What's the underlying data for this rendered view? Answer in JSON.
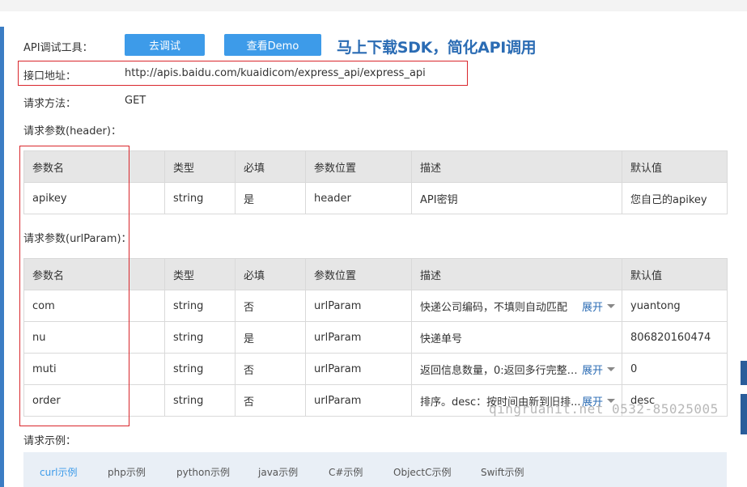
{
  "colors": {
    "accent": "#3d9be9",
    "link": "#2b6cb4",
    "highlight_box": "#d9262c",
    "header_bg": "#e6e6e6"
  },
  "api_tools": {
    "label": "API调试工具：",
    "debug_button": "去调试",
    "demo_button": "查看Demo",
    "promo_text": "马上下载SDK，简化API调用"
  },
  "endpoint": {
    "label": "接口地址：",
    "url": "http://apis.baidu.com/kuaidicom/express_api/express_api"
  },
  "method": {
    "label": "请求方法：",
    "value": "GET"
  },
  "header_params": {
    "title": "请求参数(header)：",
    "columns": [
      "参数名",
      "类型",
      "必填",
      "参数位置",
      "描述",
      "默认值"
    ],
    "rows": [
      {
        "name": "apikey",
        "type": "string",
        "required": "是",
        "location": "header",
        "desc": "API密钥",
        "default": "您自己的apikey"
      }
    ]
  },
  "url_params": {
    "title": "请求参数(urlParam)：",
    "columns": [
      "参数名",
      "类型",
      "必填",
      "参数位置",
      "描述",
      "默认值"
    ],
    "expand_label": "展开",
    "rows": [
      {
        "name": "com",
        "type": "string",
        "required": "否",
        "location": "urlParam",
        "desc": "快递公司编码，不填则自动匹配",
        "default": "yuantong"
      },
      {
        "name": "nu",
        "type": "string",
        "required": "是",
        "location": "urlParam",
        "desc": "快递单号",
        "default": "806820160474"
      },
      {
        "name": "muti",
        "type": "string",
        "required": "否",
        "location": "urlParam",
        "desc": "返回信息数量，0:返回多行完整的...",
        "default": "0"
      },
      {
        "name": "order",
        "type": "string",
        "required": "否",
        "location": "urlParam",
        "desc": "排序。desc：按时间由新到旧排...",
        "default": "desc"
      }
    ]
  },
  "examples": {
    "title": "请求示例：",
    "tabs": [
      "curl示例",
      "php示例",
      "python示例",
      "java示例",
      "C#示例",
      "ObjectC示例",
      "Swift示例"
    ]
  },
  "watermark": "qingruanit.net 0532-85025005"
}
